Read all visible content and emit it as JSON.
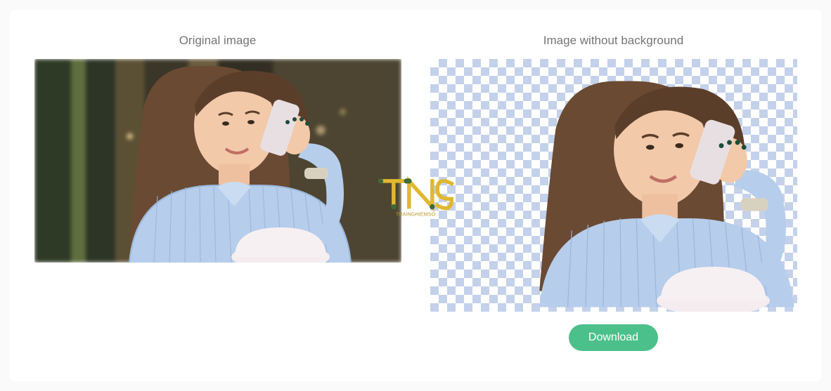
{
  "left_label": "Original image",
  "right_label": "Image without background",
  "download_label": "Download",
  "watermark": {
    "brand": "TNS",
    "tagline": "TRAINGHIEMSO"
  }
}
